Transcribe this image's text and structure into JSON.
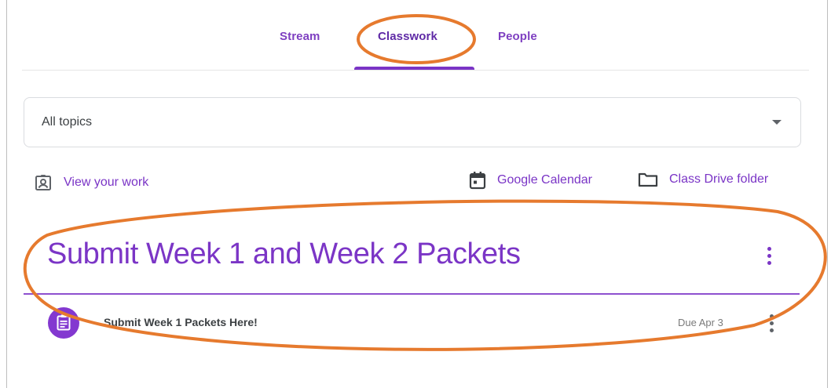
{
  "tabs": {
    "stream": "Stream",
    "classwork": "Classwork",
    "people": "People"
  },
  "topic_select": {
    "value": "All topics",
    "icon": "dropdown-caret-icon"
  },
  "actions": {
    "view_work": {
      "label": "View your work",
      "icon": "assignment-ind-icon"
    },
    "calendar": {
      "label": "Google Calendar",
      "icon": "calendar-icon"
    },
    "drive": {
      "label": "Class Drive folder",
      "icon": "folder-icon"
    }
  },
  "topic": {
    "title": "Submit Week 1 and Week 2 Packets",
    "menu_icon": "more-vert-icon"
  },
  "assignment": {
    "title": "Submit Week 1 Packets Here!",
    "due": "Due Apr 3",
    "icon": "assignment-icon"
  },
  "colors": {
    "accent": "#7a34c6",
    "annotation": "#e67a2e",
    "text": "#3c4043"
  }
}
